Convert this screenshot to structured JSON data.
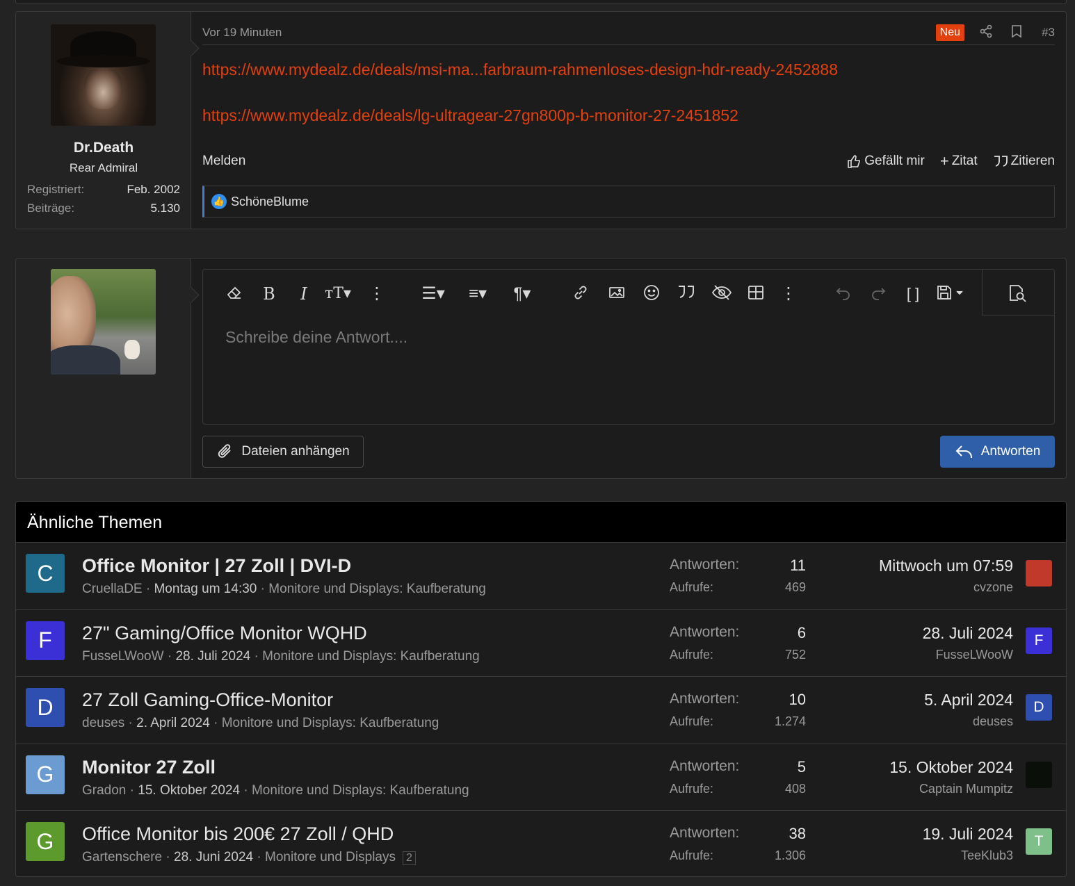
{
  "post": {
    "author": {
      "name": "Dr.Death",
      "title": "Rear Admiral"
    },
    "stats": [
      {
        "label": "Registriert:",
        "value": "Feb. 2002"
      },
      {
        "label": "Beiträge:",
        "value": "5.130"
      }
    ],
    "time": "Vor 19 Minuten",
    "badge": "Neu",
    "number": "#3",
    "links": [
      "https://www.mydealz.de/deals/msi-ma...farbraum-rahmenloses-design-hdr-ready-2452888",
      "https://www.mydealz.de/deals/lg-ultragear-27gn800p-b-monitor-27-2451852"
    ],
    "report_label": "Melden",
    "like_label": "Gefällt mir",
    "quote_add_label": "Zitat",
    "quote_label": "Zitieren",
    "reaction_user": "SchöneBlume"
  },
  "reply": {
    "placeholder": "Schreibe deine Antwort....",
    "attach_label": "Dateien anhängen",
    "submit_label": "Antworten"
  },
  "similar": {
    "title": "Ähnliche Themen",
    "replies_label": "Antworten:",
    "views_label": "Aufrufe:",
    "threads": [
      {
        "initial": "C",
        "color": "#1f6a8a",
        "title": "Office Monitor | 27 Zoll | DVI-D",
        "bold": true,
        "author": "CruellaDE",
        "date": "Montag um 14:30",
        "forum": "Monitore und Displays: Kaufberatung",
        "replies": "11",
        "views": "469",
        "last_date": "Mittwoch um 07:59",
        "last_user": "cvzone",
        "last_initial": "",
        "last_color": "#c0392b"
      },
      {
        "initial": "F",
        "color": "#3b2fd6",
        "title": "27\" Gaming/Office Monitor WQHD",
        "bold": false,
        "author": "FusseLWooW",
        "date": "28. Juli 2024",
        "forum": "Monitore und Displays: Kaufberatung",
        "replies": "6",
        "views": "752",
        "last_date": "28. Juli 2024",
        "last_user": "FusseLWooW",
        "last_initial": "F",
        "last_color": "#3b2fd6"
      },
      {
        "initial": "D",
        "color": "#2f4fb0",
        "title": "27 Zoll Gaming-Office-Monitor",
        "bold": false,
        "author": "deuses",
        "date": "2. April 2024",
        "forum": "Monitore und Displays: Kaufberatung",
        "replies": "10",
        "views": "1.274",
        "last_date": "5. April 2024",
        "last_user": "deuses",
        "last_initial": "D",
        "last_color": "#2f4fb0"
      },
      {
        "initial": "G",
        "color": "#6b9bd0",
        "title": "Monitor 27 Zoll",
        "bold": true,
        "author": "Gradon",
        "date": "15. Oktober 2024",
        "forum": "Monitore und Displays: Kaufberatung",
        "replies": "5",
        "views": "408",
        "last_date": "15. Oktober 2024",
        "last_user": "Captain Mumpitz",
        "last_initial": "",
        "last_color": "#0a0f0a"
      },
      {
        "initial": "G",
        "color": "#5c9a2e",
        "title": "Office Monitor bis 200€ 27 Zoll / QHD",
        "bold": false,
        "author": "Gartenschere",
        "date": "28. Juni 2024",
        "forum": "Monitore und Displays",
        "page": "2",
        "replies": "38",
        "views": "1.306",
        "last_date": "19. Juli 2024",
        "last_user": "TeeKlub3",
        "last_initial": "T",
        "last_color": "#7fc08a"
      }
    ]
  }
}
